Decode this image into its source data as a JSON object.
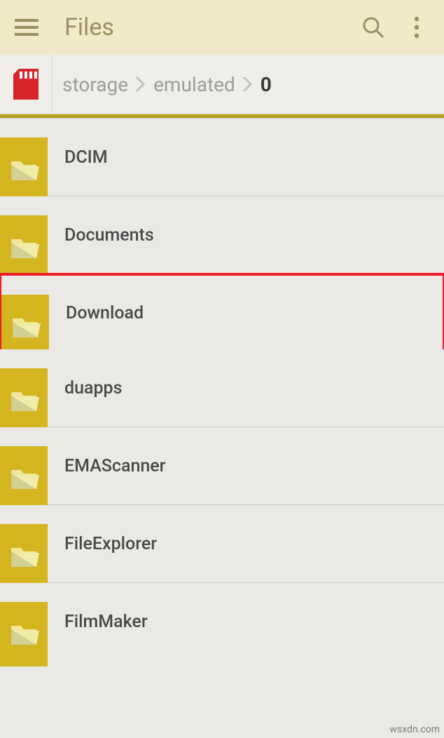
{
  "header": {
    "title": "Files"
  },
  "breadcrumb": {
    "items": [
      "storage",
      "emulated",
      "0"
    ]
  },
  "folders": [
    {
      "name": "DCIM",
      "highlighted": false
    },
    {
      "name": "Documents",
      "highlighted": false
    },
    {
      "name": "Download",
      "highlighted": true
    },
    {
      "name": "duapps",
      "highlighted": false
    },
    {
      "name": "EMAScanner",
      "highlighted": false
    },
    {
      "name": "FileExplorer",
      "highlighted": false
    },
    {
      "name": "FilmMaker",
      "highlighted": false
    }
  ],
  "watermark": "wsxdn.com"
}
